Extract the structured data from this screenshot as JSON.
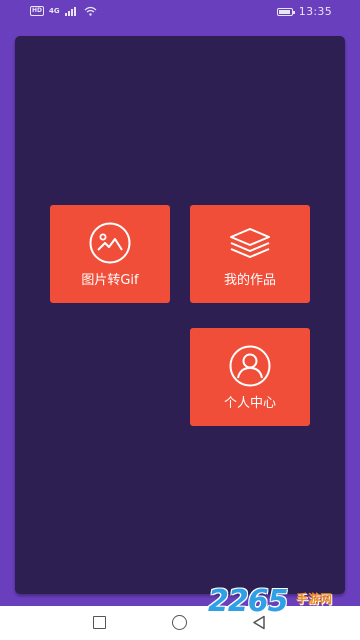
{
  "status_bar": {
    "network_badge": "HD",
    "network_type": "4G",
    "time": "13:35",
    "battery_level": 0.9
  },
  "menu": {
    "tiles": [
      {
        "label": "图片转Gif",
        "icon": "image-icon"
      },
      {
        "label": "我的作品",
        "icon": "layers-icon"
      },
      {
        "label": "个人中心",
        "icon": "user-icon"
      }
    ]
  },
  "nav_bar": {
    "buttons": [
      "recents-button",
      "home-button",
      "back-button"
    ]
  },
  "watermark": {
    "text": "2265",
    "subtext": "手游网"
  },
  "colors": {
    "status_bar": "#6a3fbd",
    "background": "#2e1f52",
    "tile": "#f04e38",
    "tile_text": "#ffffff"
  }
}
